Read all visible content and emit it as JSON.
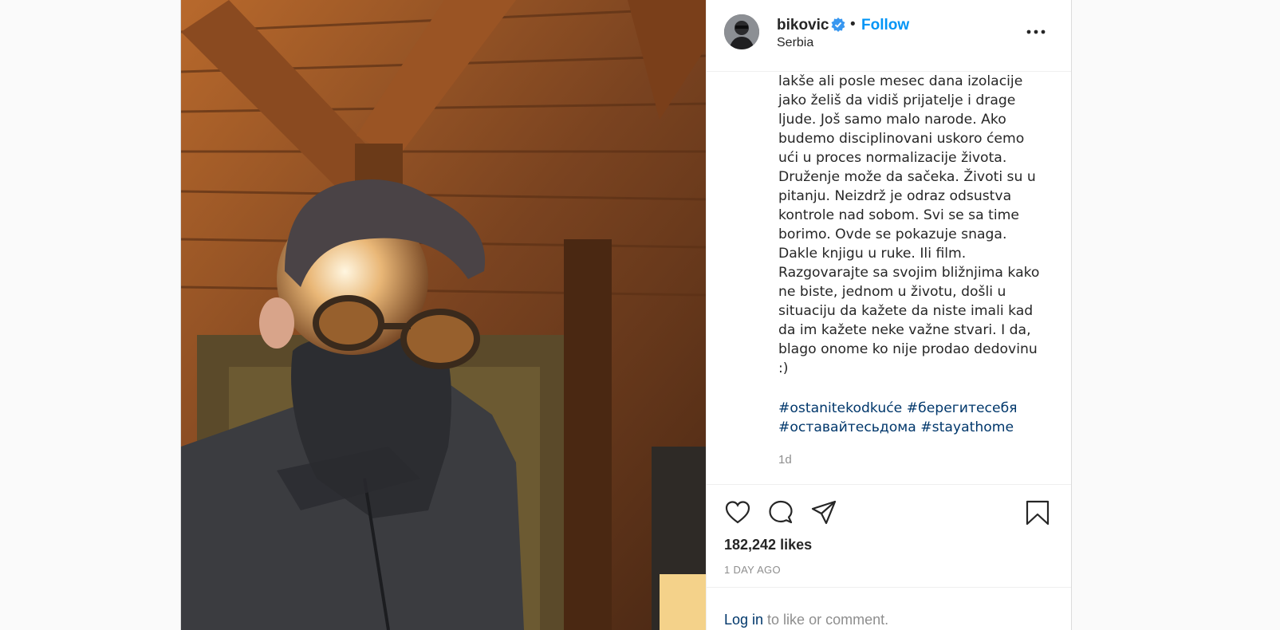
{
  "post": {
    "username": "bikovic",
    "verified_icon": "verified-badge-icon",
    "separator": "•",
    "follow_label": "Follow",
    "location": "Serbia",
    "caption": "Jeste da sam u prirodi i da je ovde\nlakše ali posle mesec dana izolacije\njako želiš da vidiš prijatelje i drage\nljude. Još samo malo narode. Ako\nbudemo disciplinovani uskoro ćemo\nući u proces normalizacije života.\nDruženje može da sačeka. Životi su u\npitanju. Neizdrž je odraz odsustva\nkontrole nad sobom. Svi se sa time\nborimo. Ovde se pokazuje snaga.\nDakle knjigu u ruke. Ili film.\nRazgovarajte sa svojim bližnjima kako\nne biste, jednom u životu, došli u\nsituaciju da kažete da niste imali kad\nda im kažete neke važne stvari. I da,\nblago onome ko nije prodao dedovinu\n:)",
    "hashtags": [
      "#ostanitekodkuće",
      "#берегитесебя",
      "#оставайтесьдома",
      "#stayathome"
    ],
    "caption_age": "1d",
    "likes": "182,242 likes",
    "posted": "1 DAY AGO"
  },
  "login": {
    "link": "Log in",
    "rest": " to like or comment."
  },
  "icons": {
    "like": "heart-icon",
    "comment": "comment-icon",
    "share": "share-icon",
    "save": "bookmark-icon",
    "more": "more-options-icon"
  }
}
